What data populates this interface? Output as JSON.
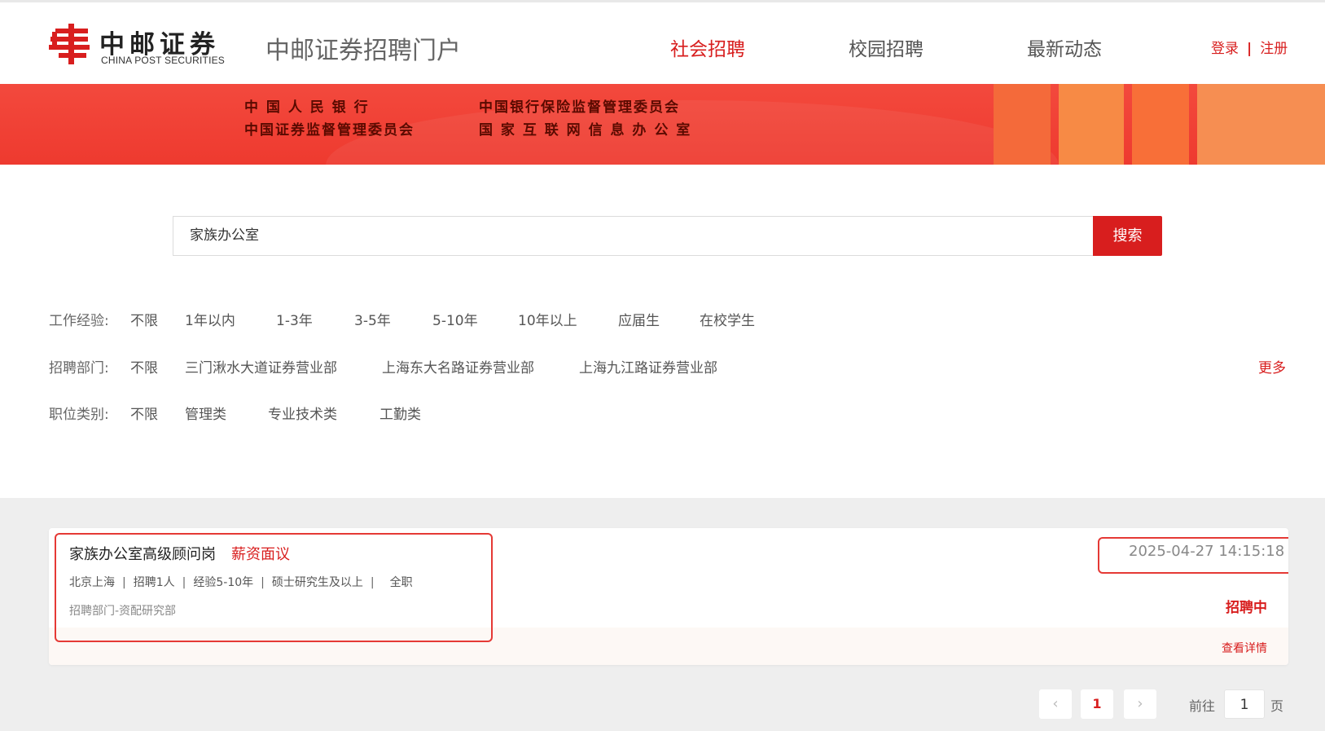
{
  "header": {
    "logo_cn": "中邮证券",
    "logo_en": "CHINA POST SECURITIES",
    "portal_title": "中邮证券招聘门户",
    "nav": [
      {
        "label": "社会招聘",
        "active": true
      },
      {
        "label": "校园招聘",
        "active": false
      },
      {
        "label": "最新动态",
        "active": false
      }
    ],
    "login": "登录",
    "separator": "|",
    "register": "注册"
  },
  "banner": {
    "line1_left": "中 国 人 民 银 行",
    "line2_left": "中国证券监督管理委员会",
    "line1_right": "中国银行保险监督管理委员会",
    "line2_right": "国 家 互 联 网 信 息 办 公 室"
  },
  "search": {
    "value": "家族办公室",
    "button_label": "搜索"
  },
  "filters": {
    "experience": {
      "label": "工作经验:",
      "options": [
        "不限",
        "1年以内",
        "1-3年",
        "3-5年",
        "5-10年",
        "10年以上",
        "应届生",
        "在校学生"
      ]
    },
    "department": {
      "label": "招聘部门:",
      "options": [
        "不限",
        "三门湫水大道证券营业部",
        "上海东大名路证券营业部",
        "上海九江路证券营业部"
      ],
      "more": "更多"
    },
    "category": {
      "label": "职位类别:",
      "options": [
        "不限",
        "管理类",
        "专业技术类",
        "工勤类"
      ]
    }
  },
  "jobs": [
    {
      "title": "家族办公室高级顾问岗",
      "salary": "薪资面议",
      "location": "北京上海",
      "headcount": "招聘1人",
      "experience": "经验5-10年",
      "education": "硕士研究生及以上",
      "type": "全职",
      "department": "招聘部门-资配研究部",
      "time": "2025-04-27 14:15:18",
      "status": "招聘中",
      "detail_label": "查看详情"
    }
  ],
  "pagination": {
    "prev": "‹",
    "current": "1",
    "next": "›",
    "goto_prefix": "前往",
    "goto_value": "1",
    "goto_suffix": "页"
  },
  "colors": {
    "accent": "#d81e1e",
    "banner": "#ee3a2f",
    "list_bg": "#eeeeee"
  }
}
